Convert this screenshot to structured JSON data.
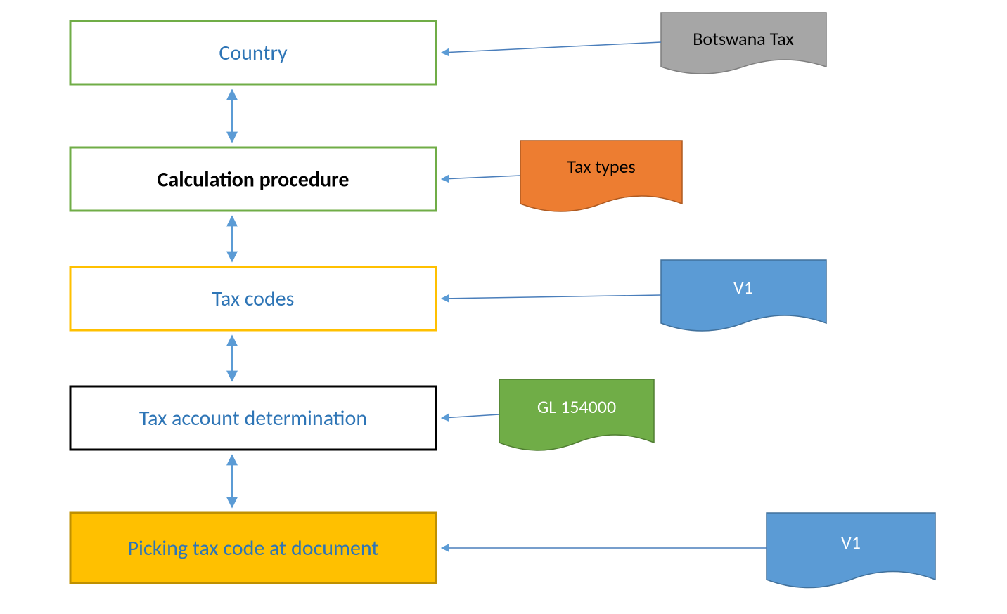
{
  "boxes": {
    "country": {
      "label": "Country",
      "textColor": "#2E75B6",
      "bold": false
    },
    "calcproc": {
      "label": "Calculation procedure",
      "textColor": "#000000",
      "bold": true
    },
    "taxcodes": {
      "label": "Tax codes",
      "textColor": "#2E75B6",
      "bold": false
    },
    "taxacct": {
      "label": "Tax account determination",
      "textColor": "#2E75B6",
      "bold": false
    },
    "picktax": {
      "label": "Picking tax code at document",
      "textColor": "#2E75B6",
      "bold": false
    }
  },
  "docs": {
    "botswana": {
      "label": "Botswana Tax",
      "textColor": "#000000"
    },
    "taxtypes": {
      "label": "Tax types",
      "textColor": "#000000"
    },
    "v1a": {
      "label": "V1",
      "textColor": "#FFFFFF"
    },
    "gl": {
      "label": "GL  154000",
      "textColor": "#FFFFFF"
    },
    "v1b": {
      "label": "V1",
      "textColor": "#FFFFFF"
    }
  },
  "colors": {
    "green": "#70AD47",
    "orange": "#ED7D31",
    "amber": "#FFC000",
    "amberBorder": "#BF9000",
    "blue": "#5B9BD5",
    "blueLine": "#4A7EBB",
    "gray": "#A6A6A6",
    "docGreen": "#70AD47",
    "black": "#000000",
    "white": "#FFFFFF",
    "textBlue": "#2E75B6"
  }
}
